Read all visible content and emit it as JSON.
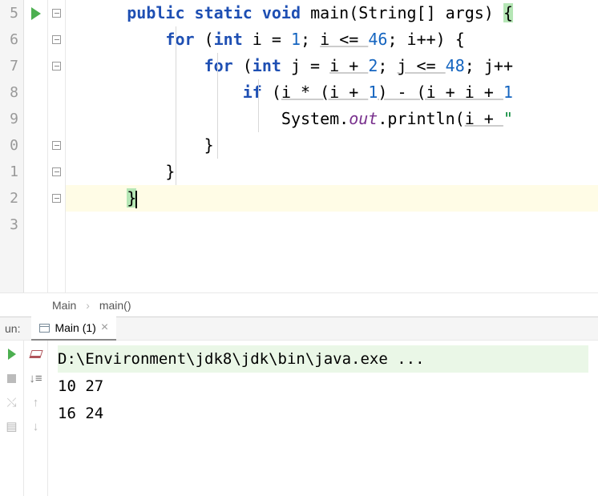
{
  "gutter": {
    "lines": [
      "5",
      "6",
      "7",
      "8",
      "9",
      "0",
      "1",
      "2",
      "3"
    ]
  },
  "code": {
    "line5": {
      "kw_public": "public",
      "kw_static": "static",
      "kw_void": "void",
      "name": "main",
      "params": "(String[] args) ",
      "brace": "{"
    },
    "line6": {
      "kw_for": "for",
      "p1": " (",
      "kw_int": "int",
      "var1": " i = ",
      "n1": "1",
      "p2": "; ",
      "cond": "i <= ",
      "n2": "46",
      "p3": "; ",
      "inc": "i++) {"
    },
    "line7": {
      "kw_for": "for",
      "p1": " (",
      "kw_int": "int",
      "var1": " j = ",
      "var2": "i + ",
      "n1": "2",
      "p2": "; ",
      "cond": "j <= ",
      "n2": "48",
      "p3": "; ",
      "inc": "j++"
    },
    "line8": {
      "kw_if": "if",
      "p1": " (",
      "e1": "i * (i + ",
      "n1": "1",
      "e2": ") - (i + i + ",
      "n2": "1"
    },
    "line9": {
      "sys": "System.",
      "out": "out",
      "pr": ".println(",
      "var": "i + ",
      "q": "\""
    },
    "line10": {
      "brace": "}"
    },
    "line11": {
      "brace": "}"
    },
    "line12": {
      "brace": "}"
    }
  },
  "breadcrumbs": {
    "class": "Main",
    "method": "main()"
  },
  "runPanel": {
    "label": "un:",
    "tabName": "Main (1)"
  },
  "console": {
    "cmd": "D:\\Environment\\jdk8\\jdk\\bin\\java.exe ...",
    "out1": "10 27",
    "out2": "16 24"
  }
}
